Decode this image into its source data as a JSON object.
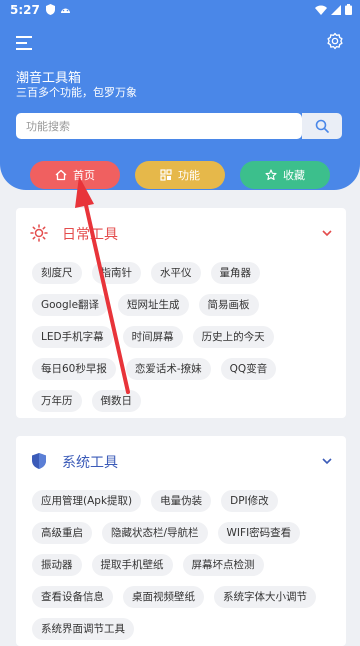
{
  "status_bar": {
    "time": "5:27"
  },
  "header": {
    "title": "潮音工具箱",
    "subtitle": "三百多个功能，包罗万象"
  },
  "search": {
    "placeholder": "功能搜索",
    "value": ""
  },
  "tabs": [
    {
      "label": "首页",
      "icon": "home-icon",
      "color": "#f06060"
    },
    {
      "label": "功能",
      "icon": "grid-icon",
      "color": "#e6b84a"
    },
    {
      "label": "收藏",
      "icon": "star-icon",
      "color": "#3cbf8c"
    }
  ],
  "sections": [
    {
      "title": "日常工具",
      "title_color": "#e44c4c",
      "icon": "sun-icon",
      "items": [
        "刻度尺",
        "指南针",
        "水平仪",
        "量角器",
        "Google翻译",
        "短网址生成",
        "简易画板",
        "LED手机字幕",
        "时间屏幕",
        "历史上的今天",
        "每日60秒早报",
        "恋爱话术-撩妹",
        "QQ变音",
        "万年历",
        "倒数日"
      ]
    },
    {
      "title": "系统工具",
      "title_color": "#3b5bb8",
      "icon": "shield-icon",
      "items": [
        "应用管理(Apk提取)",
        "电量伪装",
        "DPI修改",
        "高级重启",
        "隐藏状态栏/导航栏",
        "WIFI密码查看",
        "振动器",
        "提取手机壁纸",
        "屏幕坏点检测",
        "查看设备信息",
        "桌面视频壁纸",
        "系统字体大小调节",
        "系统界面调节工具"
      ]
    }
  ],
  "colors": {
    "header_bg": "#4a87e8",
    "page_bg": "#eef0f4",
    "arrow": "#e8343a"
  }
}
